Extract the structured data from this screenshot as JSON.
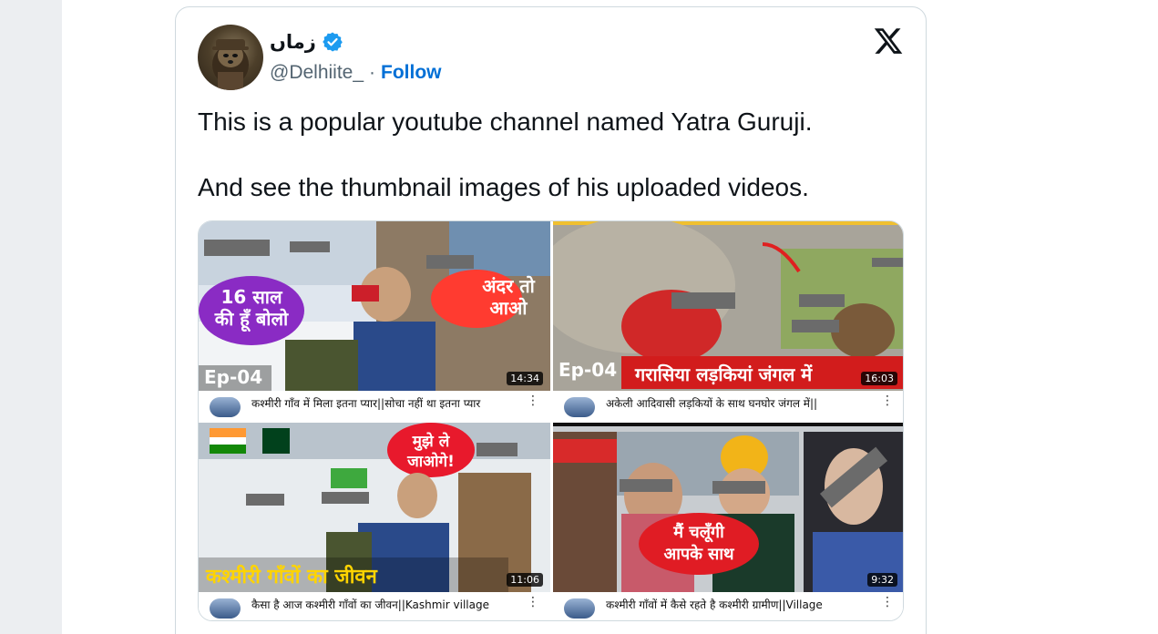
{
  "tweet": {
    "display_name": "زماں",
    "handle": "@Delhiite_",
    "separator": "·",
    "follow_label": "Follow",
    "text_line1": "This is a popular youtube channel named Yatra Guruji.",
    "text_line2": "And see the thumbnail images of his uploaded videos."
  },
  "icons": {
    "verified": "verified-badge-icon",
    "platform": "x-logo-icon",
    "more": "vertical-ellipsis-icon"
  },
  "colors": {
    "follow": "#006fd6",
    "verified": "#1d9bf0",
    "text": "#0f1419",
    "muted": "#536471"
  },
  "videos": [
    {
      "overlay_left": "16 साल\nकी हूँ बोलो",
      "overlay_right": "अंदर तो\nआओ",
      "episode": "Ep-04",
      "duration": "14:34",
      "title": "कश्मीरी गाँव में मिला इतना प्यार||सोचा नहीं था इतना प्यार",
      "more": "⋮"
    },
    {
      "overlay_bottom": "गरासिया लड़कियां जंगल में",
      "episode": "Ep-04",
      "duration": "16:03",
      "title": "अकेली आदिवासी लड़कियों के साथ घनघोर जंगल में||",
      "more": "⋮"
    },
    {
      "overlay_bubble": "मुझे ले\nजाओगे!",
      "overlay_bottom": "कश्मीरी गाँवों का जीवन",
      "duration": "11:06",
      "title": "कैसा है आज कश्मीरी गाँवों का जीवन||Kashmir village",
      "more": "⋮"
    },
    {
      "overlay_bubble": "मैं चलूँगी\nआपके साथ",
      "duration": "9:32",
      "title": "कश्मीरी गाँवों में कैसे रहते है कश्मीरी ग्रामीण||Village",
      "more": "⋮"
    }
  ]
}
